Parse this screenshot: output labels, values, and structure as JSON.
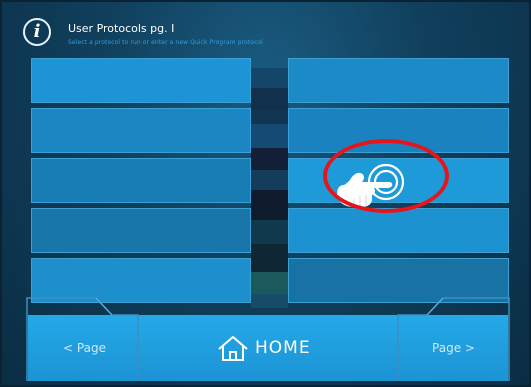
{
  "header": {
    "info_icon": "info-icon",
    "title": "User Protocols pg. I",
    "subtitle": "Select a protocol to run or enter a new Quick Program protocol"
  },
  "protocol_buttons": {
    "left": [
      "",
      "",
      "",
      "",
      ""
    ],
    "right": [
      "",
      "",
      "",
      "",
      ""
    ]
  },
  "colors": {
    "button_blue": "#1b93d4",
    "button_border": "#3aa0d6",
    "highlight_red": "#e4161b",
    "background_dark": "#0a2d44"
  },
  "annotation": {
    "gesture_icon": "pointing-hand-icon",
    "highlight": "red-ellipse"
  },
  "nav": {
    "prev_label": "< Page",
    "home_label": "HOME",
    "home_icon": "house-icon",
    "next_label": "Page >"
  }
}
